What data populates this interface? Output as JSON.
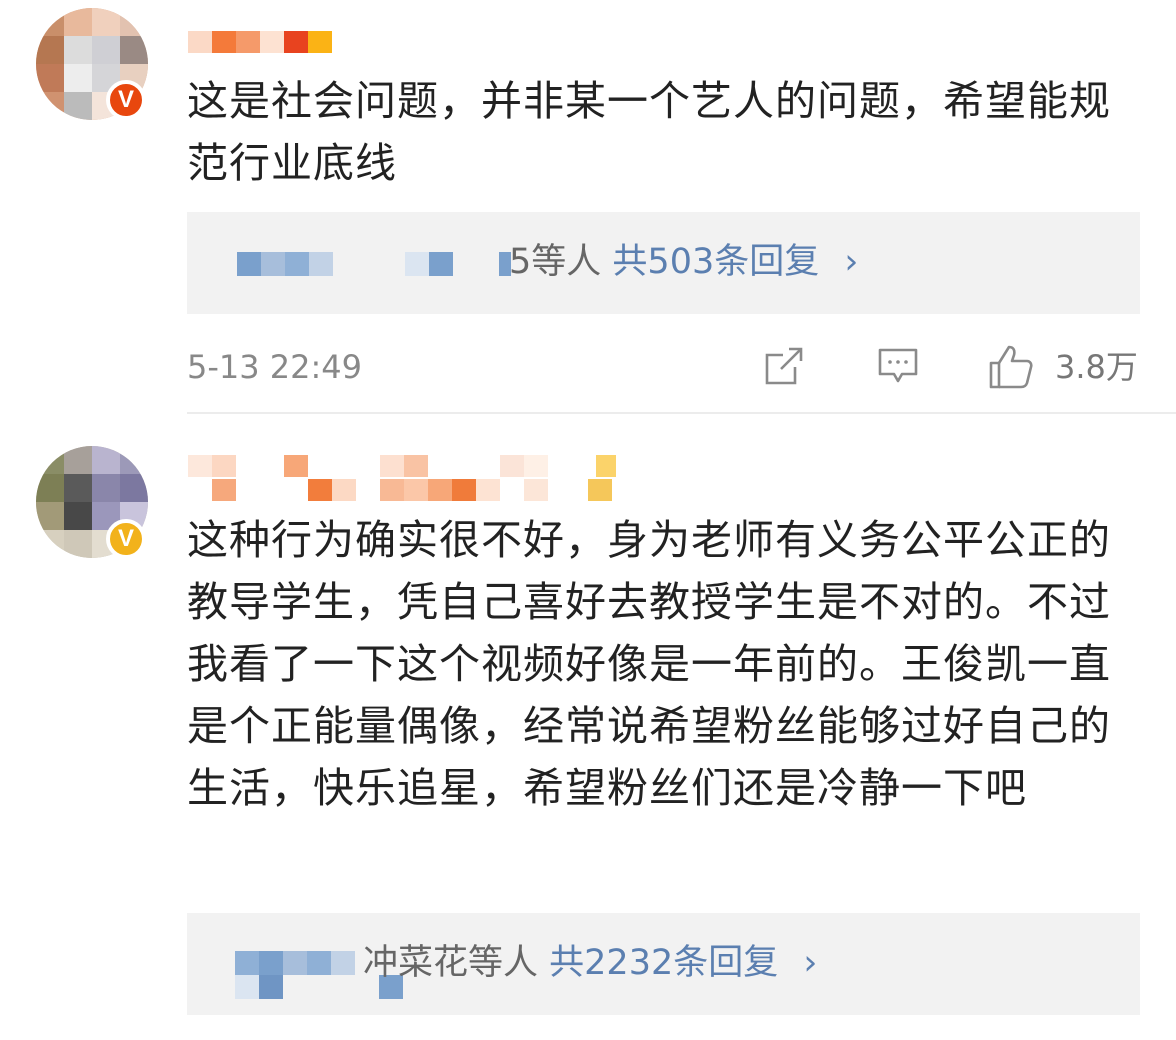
{
  "comments": [
    {
      "text": "这是社会问题，并非某一个艺人的问题，希望能规范行业底线",
      "replies": {
        "users_suffix": "5等人",
        "count_label": "共503条回复",
        "arrow": "›"
      },
      "timestamp": "5-13 22:49",
      "like_count": "3.8万",
      "badge": "V",
      "badge_color": "#e8470e"
    },
    {
      "text": "这种行为确实很不好，身为老师有义务公平公正的教导学生，凭自己喜好去教授学生是不对的。不过我看了一下这个视频好像是一年前的。王俊凯一直是个正能量偶像，经常说希望粉丝能够过好自己的生活，快乐追星，希望粉丝们还是冷静一下吧",
      "replies": {
        "users_suffix": "冲菜花等人",
        "count_label": "共2232条回复",
        "arrow": "›"
      },
      "badge": "V",
      "badge_color": "#f2b21b"
    }
  ],
  "icons": [
    "share-icon",
    "comment-icon",
    "like-icon"
  ],
  "colors": {
    "link": "#5b7fb0",
    "reply_bg": "#f2f2f2",
    "meta_text": "#888888"
  }
}
